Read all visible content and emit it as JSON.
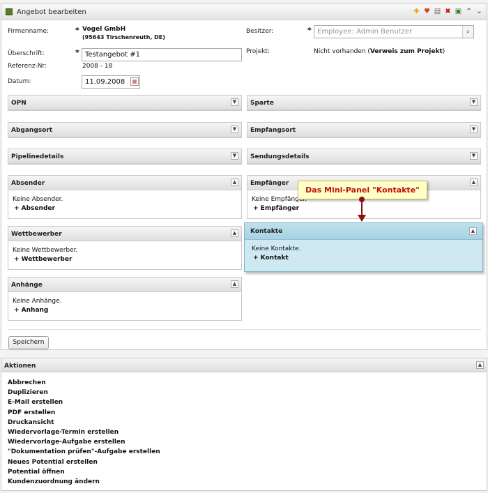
{
  "window": {
    "title": "Angebot bearbeiten"
  },
  "toolbar_icons": [
    {
      "name": "add-icon",
      "glyph": "✚",
      "color": "#e6a200"
    },
    {
      "name": "favorite-icon",
      "glyph": "♥",
      "color": "#d8401a"
    },
    {
      "name": "document-icon",
      "glyph": "▤",
      "color": "#666666"
    },
    {
      "name": "delete-icon",
      "glyph": "✖",
      "color": "#cc1111"
    },
    {
      "name": "save-icon",
      "glyph": "▣",
      "color": "#3a7a2a"
    },
    {
      "name": "collapse-icon",
      "glyph": "⌃",
      "color": "#555555"
    },
    {
      "name": "expand-icon",
      "glyph": "⌄",
      "color": "#555555"
    }
  ],
  "form": {
    "firmenname_label": "Firmenname:",
    "firmenname_value": "Vogel GmbH",
    "firmenname_address": "(95643 Tirschenreuth, DE)",
    "besitzer_label": "Besitzer:",
    "besitzer_placeholder": "Employee: Admin Benutzer",
    "ueberschrift_label": "Überschrift:",
    "ueberschrift_value": "Testangebot #1",
    "projekt_label": "Projekt:",
    "projekt_value": "Nicht vorhanden (",
    "projekt_link": "Verweis zum Projekt",
    "projekt_close": ")",
    "referenz_label": "Referenz-Nr:",
    "referenz_value": "2008 - 18",
    "datum_label": "Datum:",
    "datum_value": "11.09.2008",
    "required_mark": "*"
  },
  "collapsed_panels": {
    "opn": "OPN",
    "sparte": "Sparte",
    "abgangsort": "Abgangsort",
    "empfangsort": "Empfangsort",
    "pipelinedetails": "Pipelinedetails",
    "sendungsdetails": "Sendungsdetails"
  },
  "panels": {
    "absender": {
      "title": "Absender",
      "empty": "Keine Absender.",
      "add": "+ Absender"
    },
    "empfaenger": {
      "title": "Empfänger",
      "empty": "Keine Empfänger.",
      "add": "+ Empfänger"
    },
    "wettbewerber": {
      "title": "Wettbewerber",
      "empty": "Keine Wettbewerber.",
      "add": "+ Wettbewerber"
    },
    "kontakte": {
      "title": "Kontakte",
      "empty": "Keine Kontakte.",
      "add": "+ Kontakt"
    },
    "anhaenge": {
      "title": "Anhänge",
      "empty": "Keine Anhänge.",
      "add": "+ Anhang"
    }
  },
  "callout": "Das Mini-Panel \"Kontakte\"",
  "save_button": "Speichern",
  "actions": {
    "title": "Aktionen",
    "items": [
      "Abbrechen",
      "Duplizieren",
      "E-Mail erstellen",
      "PDF erstellen",
      "Druckansicht",
      "Wiedervorlage-Termin erstellen",
      "Wiedervorlage-Aufgabe erstellen",
      "\"Dokumentation prüfen\"-Aufgabe erstellen",
      "Neues Potential erstellen",
      "Potential öffnen",
      "Kundenzuordnung ändern"
    ]
  }
}
